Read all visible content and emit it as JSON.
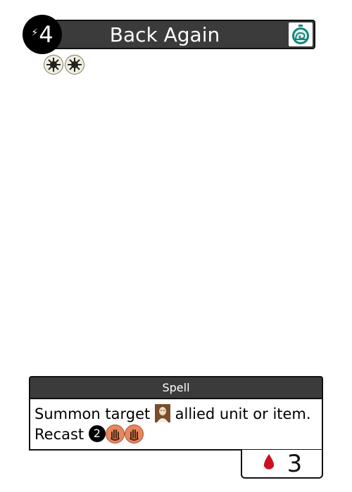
{
  "card": {
    "name": "Back Again",
    "cost": "4",
    "type": "Spell",
    "text_line1_before": "Summon target",
    "text_line1_after": "allied unit or item.",
    "text_line2_label": "Recast",
    "recast_cost": "2",
    "blood_value": "3"
  },
  "icons": {
    "cost": "lightning-bolt-icon",
    "speed": "stopwatch-snail-icon",
    "traits": [
      "sun-trait-icon",
      "sun-trait-icon"
    ],
    "target": "unit-portrait-icon",
    "recast_cost": "numbered-cost-icon",
    "recast_extra": [
      "hand-token-icon",
      "hand-token-icon"
    ],
    "blood": "blood-drop-icon"
  },
  "colors": {
    "banner": "#3b3b3b",
    "speed": "#14857b",
    "hand_token": "#e8875e",
    "blood": "#cc1020",
    "trait_token": "#f1efdc"
  }
}
